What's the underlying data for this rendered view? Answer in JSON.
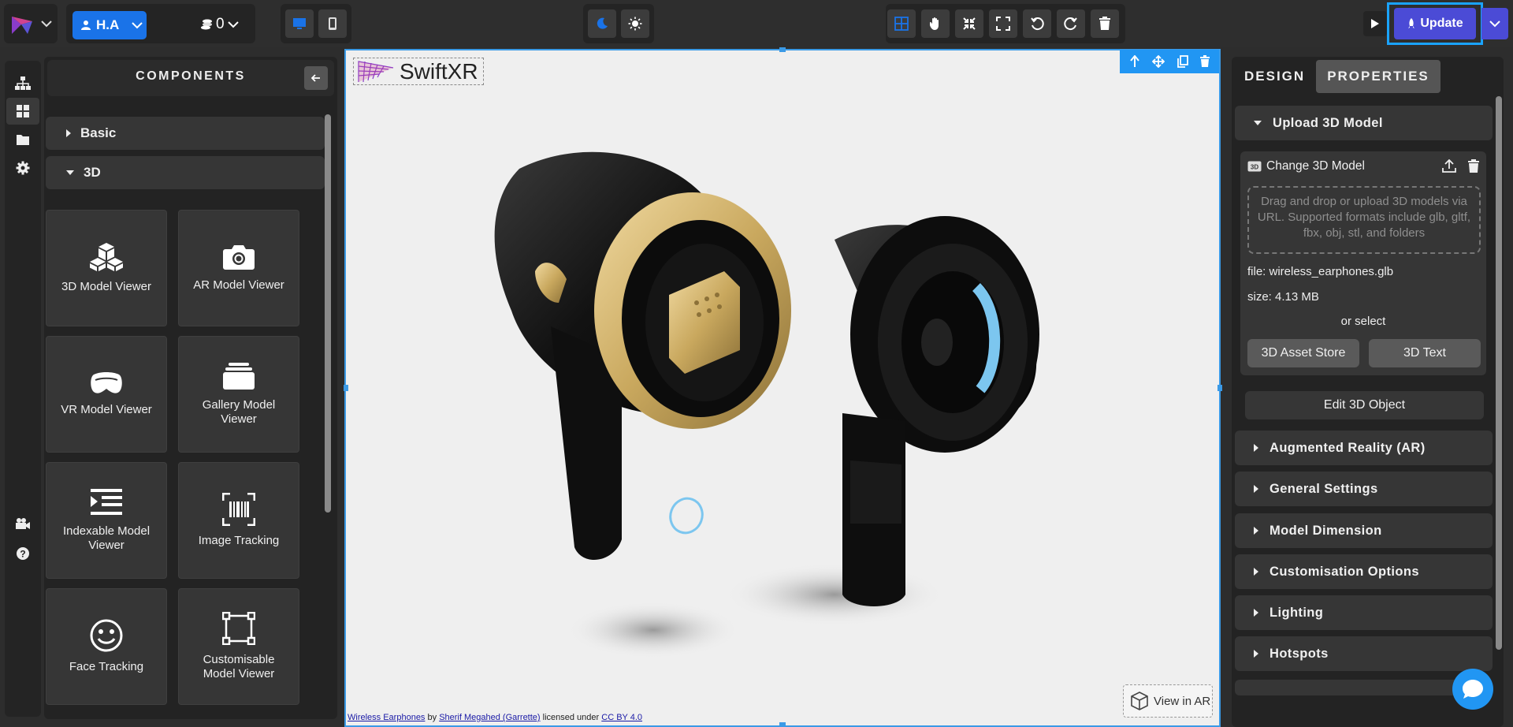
{
  "topbar": {
    "user_name": "H.A",
    "credits": "0",
    "update_label": "Update"
  },
  "components": {
    "title": "COMPONENTS",
    "accordions": [
      "Basic",
      "3D"
    ],
    "tiles": [
      {
        "label": "3D Model Viewer",
        "icon": "cubes-icon"
      },
      {
        "label": "AR Model Viewer",
        "icon": "camera-icon"
      },
      {
        "label": "VR Model Viewer",
        "icon": "vr-headset-icon"
      },
      {
        "label": "Gallery Model Viewer",
        "icon": "gallery-stack-icon"
      },
      {
        "label": "Indexable Model Viewer",
        "icon": "indexed-list-icon"
      },
      {
        "label": "Image Tracking",
        "icon": "barcode-scan-icon"
      },
      {
        "label": "Face Tracking",
        "icon": "smiley-icon"
      },
      {
        "label": "Customisable Model Viewer",
        "icon": "vector-frame-icon"
      }
    ]
  },
  "canvas": {
    "logo_text": "SwiftXR",
    "view_in_ar": "View in AR",
    "credit": {
      "model": "Wireless Earphones",
      "by": "by",
      "author": "Sherif Megahed (Garrette)",
      "licensed": "licensed under",
      "license": "CC BY 4.0"
    }
  },
  "properties": {
    "tabs": [
      "DESIGN",
      "PROPERTIES"
    ],
    "active_tab": "PROPERTIES",
    "upload_section": "Upload 3D Model",
    "change_model": "Change 3D Model",
    "drop_text": "Drag and drop or upload 3D models via URL. Supported formats include glb, gltf, fbx, obj, stl, and folders",
    "file": "file: wireless_earphones.glb",
    "size": "size: 4.13 MB",
    "or_select": "or select",
    "asset_store": "3D Asset Store",
    "text_3d": "3D Text",
    "edit_object": "Edit 3D Object",
    "sections": [
      "Augmented Reality (AR)",
      "General Settings",
      "Model Dimension",
      "Customisation Options",
      "Lighting",
      "Hotspots"
    ]
  },
  "colors": {
    "accent": "#1a73e8",
    "update": "#4b4bd6",
    "selection": "#3b9ae6"
  }
}
